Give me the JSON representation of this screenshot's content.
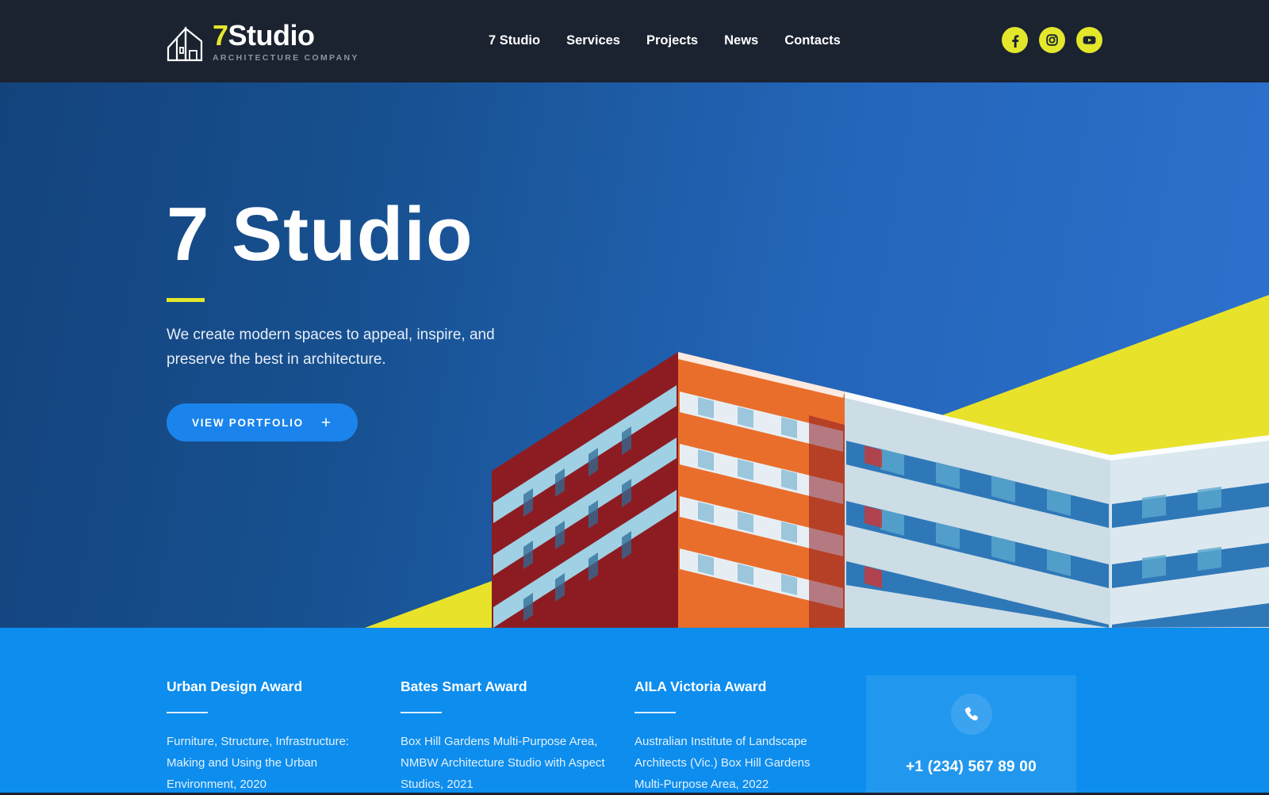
{
  "brand": {
    "logo_icon": "house-outline-icon",
    "logo_seven": "7",
    "logo_studio": "Studio",
    "logo_tagline": "ARCHITECTURE COMPANY",
    "accent_yellow": "#e3e72c",
    "header_bg": "#1b2230",
    "hero_blue_dark": "#14437c",
    "hero_blue_light": "#2d72d0",
    "awards_blue": "#0d8ded",
    "button_blue": "#1a84ec"
  },
  "nav": {
    "items": [
      {
        "label": "7 Studio"
      },
      {
        "label": "Services"
      },
      {
        "label": "Projects"
      },
      {
        "label": "News"
      },
      {
        "label": "Contacts"
      }
    ]
  },
  "socials": [
    {
      "name": "facebook-icon"
    },
    {
      "name": "instagram-icon"
    },
    {
      "name": "youtube-icon"
    }
  ],
  "hero": {
    "title": "7 Studio",
    "subtitle": "We create modern spaces to appeal, inspire, and preserve the best in architecture.",
    "button_label": "VIEW PORTFOLIO",
    "button_icon": "plus-icon"
  },
  "awards": [
    {
      "title": "Urban Design Award",
      "text": "Furniture, Structure, Infrastructure: Making and Using the Urban Environment, 2020"
    },
    {
      "title": "Bates Smart Award",
      "text": "Box Hill Gardens Multi-Purpose Area, NMBW Architecture Studio with Aspect Studios, 2021"
    },
    {
      "title": "AILA Victoria Award",
      "text": "Australian Institute of Landscape Architects (Vic.) Box Hill Gardens Multi-Purpose Area, 2022"
    }
  ],
  "contact": {
    "icon": "phone-icon",
    "phone": "+1 (234) 567 89 00"
  }
}
